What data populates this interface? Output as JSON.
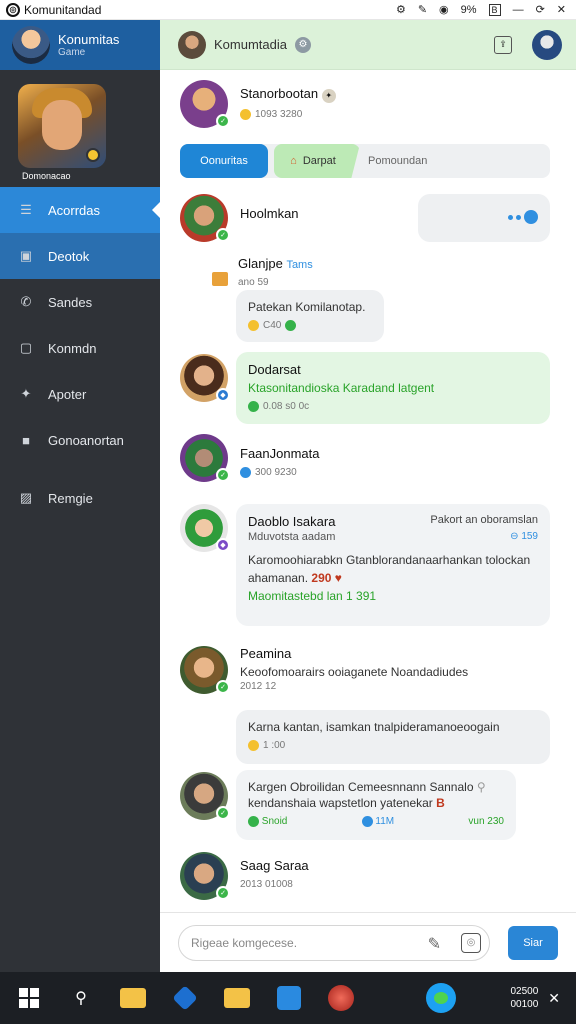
{
  "window": {
    "title": "Komunitandad",
    "tray": {
      "battery": "9%",
      "b_label": "B"
    }
  },
  "sidebar": {
    "profile_name": "Konumitas",
    "profile_sub": "Game",
    "game_caption": "Domonacao",
    "items": [
      {
        "label": "Acorrdas",
        "icon": "user-icon"
      },
      {
        "label": "Deotok",
        "icon": "chat-icon"
      },
      {
        "label": "Sandes",
        "icon": "phone-icon"
      },
      {
        "label": "Konmdn",
        "icon": "frame-icon"
      },
      {
        "label": "Apoter",
        "icon": "gamepad-icon"
      },
      {
        "label": "Gonoanortan",
        "icon": "bag-icon"
      },
      {
        "label": "Remgie",
        "icon": "image-icon"
      }
    ]
  },
  "chat": {
    "header_name": "Komumtadia",
    "tabs": [
      "Oonuritas",
      "Darpat",
      "Pomoundan"
    ],
    "messages": [
      {
        "name": "Stanorbootan",
        "meta": "1093 3280"
      },
      {
        "name": "Hoolmkan"
      },
      {
        "name": "Glanjpe",
        "tag": "Tams",
        "meta": "ano 59",
        "bubble": "Patekan Komilanotap.",
        "bubble_meta": "C40"
      },
      {
        "name": "Dodarsat",
        "line": "Ktasonitandioska Karadand latgent",
        "meta": "0.08 s0 0c"
      },
      {
        "name": "FaanJonmata",
        "meta": "300 9230"
      },
      {
        "name": "Daoblo Isakara",
        "right": "Pakort an oboramslan",
        "sub": "Mduvotsta aadam",
        "sub_right": "159",
        "body": "Karomoohiarabkn Gtanblorandanaarhankan tolockan ahamanan.",
        "num": "290",
        "foot": "Maomitastebd lan 1 391"
      },
      {
        "name": "Peamina",
        "line": "Keoofomoarairs ooiaganete Noandadiudes",
        "meta": "2012 12"
      },
      {
        "bubble": "Karna kantan, isamkan tnalpideramanoeoogain",
        "bubble_meta": "1 :00"
      },
      {
        "line1": "Kargen Obroilidan Cemeesnnann Sannalo",
        "line2": "kendanshaia wapstetlon yatenekar",
        "flag": "B",
        "m1": "Snoid",
        "m2": "11M",
        "m3": "vun 230"
      },
      {
        "name": "Saag Saraa",
        "meta": "2013 01008"
      }
    ],
    "composer_placeholder": "Rigeae komgecese.",
    "send_label": "Siar"
  },
  "taskbar": {
    "time": "02500",
    "date": "00100"
  }
}
